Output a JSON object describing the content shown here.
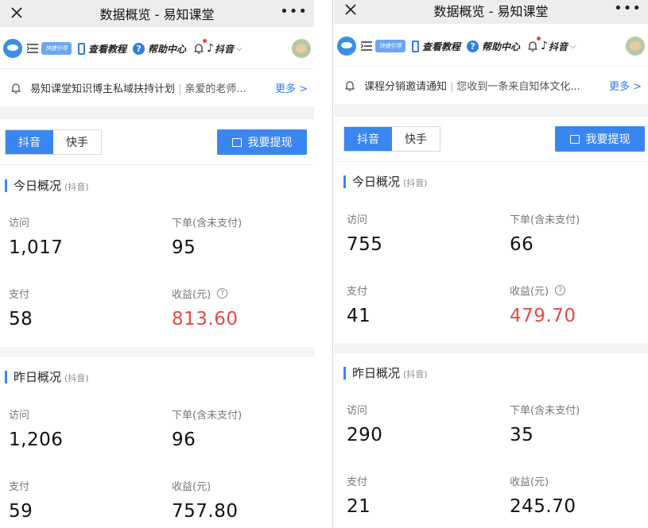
{
  "panels": [
    {
      "title": "数据概览 - 易知课堂",
      "toolbar": {
        "quick_label": "快捷引导",
        "tutorial_label": "查看教程",
        "help_label": "帮助中心",
        "platform_label": "抖音"
      },
      "notice": {
        "title": "易知课堂知识博主私域扶持计划",
        "subtitle": "亲爱的老师...",
        "more_label": "更多 >"
      },
      "tabs": [
        "抖音",
        "快手"
      ],
      "active_tab": "抖音",
      "withdraw_label": "我要提现",
      "today": {
        "title": "今日概况",
        "tag": "(抖音)",
        "visits_label": "访问",
        "visits": "1,017",
        "orders_label": "下单(含未支付)",
        "orders": "95",
        "paid_label": "支付",
        "paid": "58",
        "revenue_label": "收益(元)",
        "revenue": "813.60"
      },
      "yesterday": {
        "title": "昨日概况",
        "tag": "(抖音)",
        "visits_label": "访问",
        "visits": "1,206",
        "orders_label": "下单(含未支付)",
        "orders": "96",
        "paid_label": "支付",
        "paid": "59",
        "revenue_label": "收益(元)",
        "revenue": "757.80"
      }
    },
    {
      "title": "数据概览 - 易知课堂",
      "toolbar": {
        "quick_label": "快捷引导",
        "tutorial_label": "查看教程",
        "help_label": "帮助中心",
        "platform_label": "抖音"
      },
      "notice": {
        "title": "课程分销邀请通知",
        "subtitle": "您收到一条来自知体文化...",
        "more_label": "更多 >"
      },
      "tabs": [
        "抖音",
        "快手"
      ],
      "active_tab": "抖音",
      "withdraw_label": "我要提现",
      "today": {
        "title": "今日概况",
        "tag": "(抖音)",
        "visits_label": "访问",
        "visits": "755",
        "orders_label": "下单(含未支付)",
        "orders": "66",
        "paid_label": "支付",
        "paid": "41",
        "revenue_label": "收益(元)",
        "revenue": "479.70"
      },
      "yesterday": {
        "title": "昨日概况",
        "tag": "(抖音)",
        "visits_label": "访问",
        "visits": "290",
        "orders_label": "下单(含未支付)",
        "orders": "35",
        "paid_label": "支付",
        "paid": "21",
        "revenue_label": "收益(元)",
        "revenue": "245.70"
      }
    }
  ],
  "colors": {
    "accent": "#3a86f0",
    "revenue_today": "#e64a45",
    "titlebar_bg": "#ededed",
    "gap_bg": "#f2f3f5"
  }
}
